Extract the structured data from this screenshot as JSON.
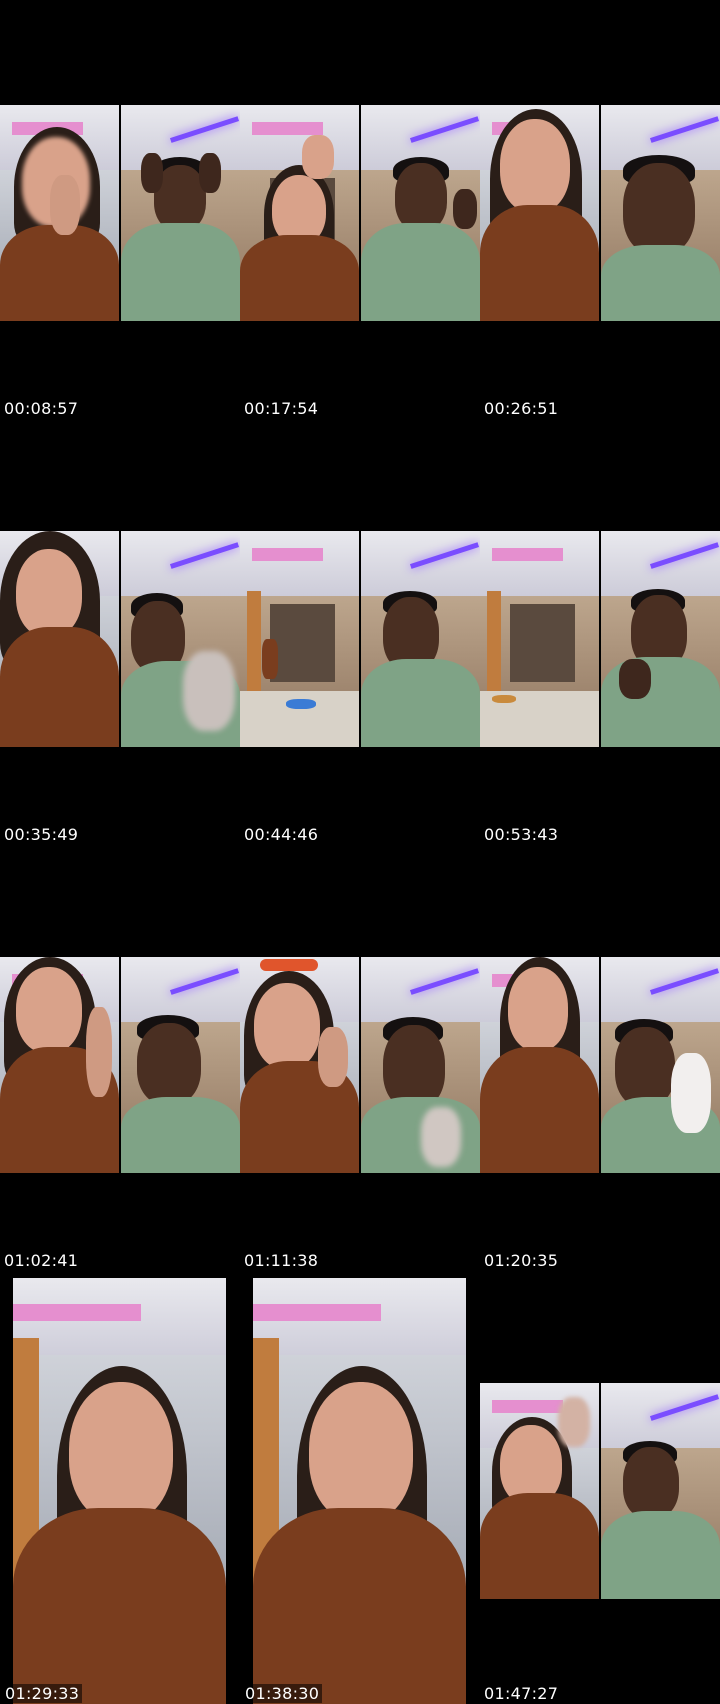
{
  "thumbnails": [
    {
      "timestamp": "00:08:57",
      "layout": "split"
    },
    {
      "timestamp": "00:17:54",
      "layout": "split"
    },
    {
      "timestamp": "00:26:51",
      "layout": "split"
    },
    {
      "timestamp": "00:35:49",
      "layout": "split"
    },
    {
      "timestamp": "00:44:46",
      "layout": "split"
    },
    {
      "timestamp": "00:53:43",
      "layout": "split"
    },
    {
      "timestamp": "01:02:41",
      "layout": "split"
    },
    {
      "timestamp": "01:11:38",
      "layout": "split"
    },
    {
      "timestamp": "01:20:35",
      "layout": "split"
    },
    {
      "timestamp": "01:29:33",
      "layout": "single"
    },
    {
      "timestamp": "01:38:30",
      "layout": "single"
    },
    {
      "timestamp": "01:47:27",
      "layout": "split"
    }
  ],
  "colors": {
    "background": "#000000",
    "timestamp_text": "#ffffff",
    "woman_top": "#7a3d1e",
    "man_shirt": "#7fa386",
    "accent_purple": "#7a4dff",
    "accent_pink": "#e58fcf"
  }
}
